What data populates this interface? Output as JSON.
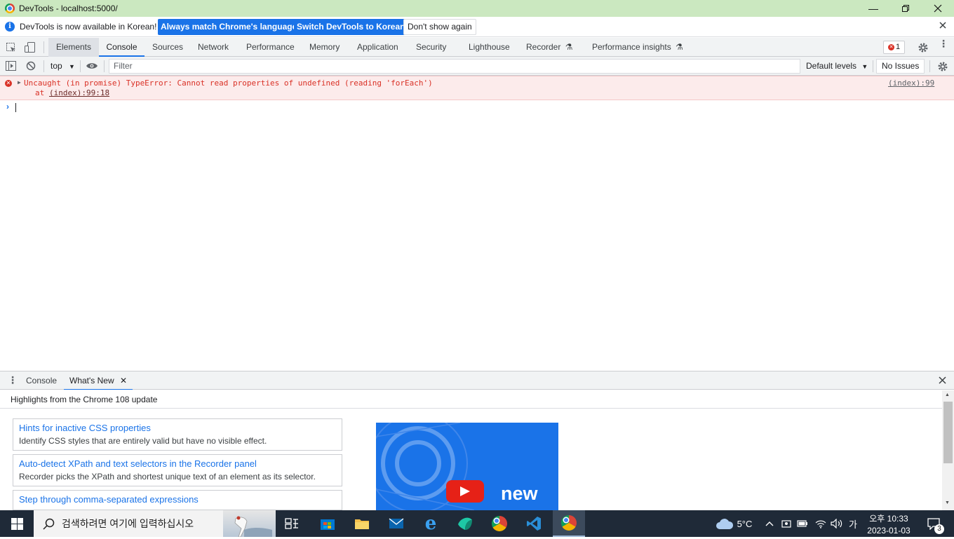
{
  "window": {
    "title": "DevTools - localhost:5000/"
  },
  "infobar": {
    "message": "DevTools is now available in Korean!",
    "btn_match": "Always match Chrome's language",
    "btn_switch": "Switch DevTools to Korean",
    "btn_dismiss": "Don't show again"
  },
  "tabs": {
    "elements": "Elements",
    "console": "Console",
    "sources": "Sources",
    "network": "Network",
    "performance": "Performance",
    "memory": "Memory",
    "application": "Application",
    "security": "Security",
    "lighthouse": "Lighthouse",
    "recorder": "Recorder",
    "perf_insights": "Performance insights",
    "error_count": "1"
  },
  "console_toolbar": {
    "context": "top",
    "filter_placeholder": "Filter",
    "levels": "Default levels",
    "issues": "No Issues"
  },
  "console": {
    "error_message": "Uncaught (in promise) TypeError: Cannot read properties of undefined (reading 'forEach')",
    "stack_prefix": "at ",
    "stack_link": "(index):99:18",
    "source_link": "(index):99"
  },
  "drawer": {
    "tab_console": "Console",
    "tab_whatsnew": "What's New",
    "header": "Highlights from the Chrome 108 update",
    "cards": [
      {
        "title": "Hints for inactive CSS properties",
        "desc": "Identify CSS styles that are entirely valid but have no visible effect."
      },
      {
        "title": "Auto-detect XPath and text selectors in the Recorder panel",
        "desc": "Recorder picks the XPath and shortest unique text of an element as its selector."
      },
      {
        "title": "Step through comma-separated expressions",
        "desc": ""
      }
    ],
    "video_text": "new"
  },
  "taskbar": {
    "search_placeholder": "검색하려면 여기에 입력하십시오",
    "weather": "5°C",
    "ime": "가",
    "time": "오후 10:33",
    "date": "2023-01-03",
    "notification_count": "3"
  },
  "colors": {
    "accent": "#1a73e8",
    "error": "#d93025",
    "titlebar": "#cbe8c0",
    "taskbar": "#1f2a38"
  }
}
